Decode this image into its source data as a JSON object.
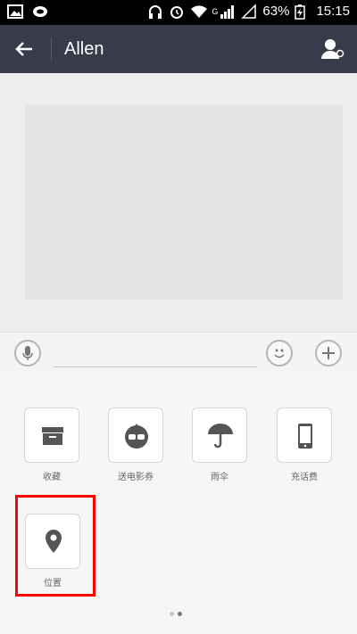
{
  "status_bar": {
    "battery": "63%",
    "time": "15:15",
    "signal_label": "G"
  },
  "header": {
    "title": "Allen"
  },
  "panel": {
    "items": [
      {
        "label": "收藏",
        "icon": "inbox-icon"
      },
      {
        "label": "送电影券",
        "icon": "glasses-face-icon"
      },
      {
        "label": "雨伞",
        "icon": "umbrella-icon"
      },
      {
        "label": "充话费",
        "icon": "phone-icon"
      },
      {
        "label": "位置",
        "icon": "location-pin-icon"
      }
    ],
    "page_count": 2,
    "active_page": 2
  },
  "colors": {
    "header_bg": "#383b4a",
    "highlight": "#ff0000",
    "tile_icon": "#555555"
  }
}
